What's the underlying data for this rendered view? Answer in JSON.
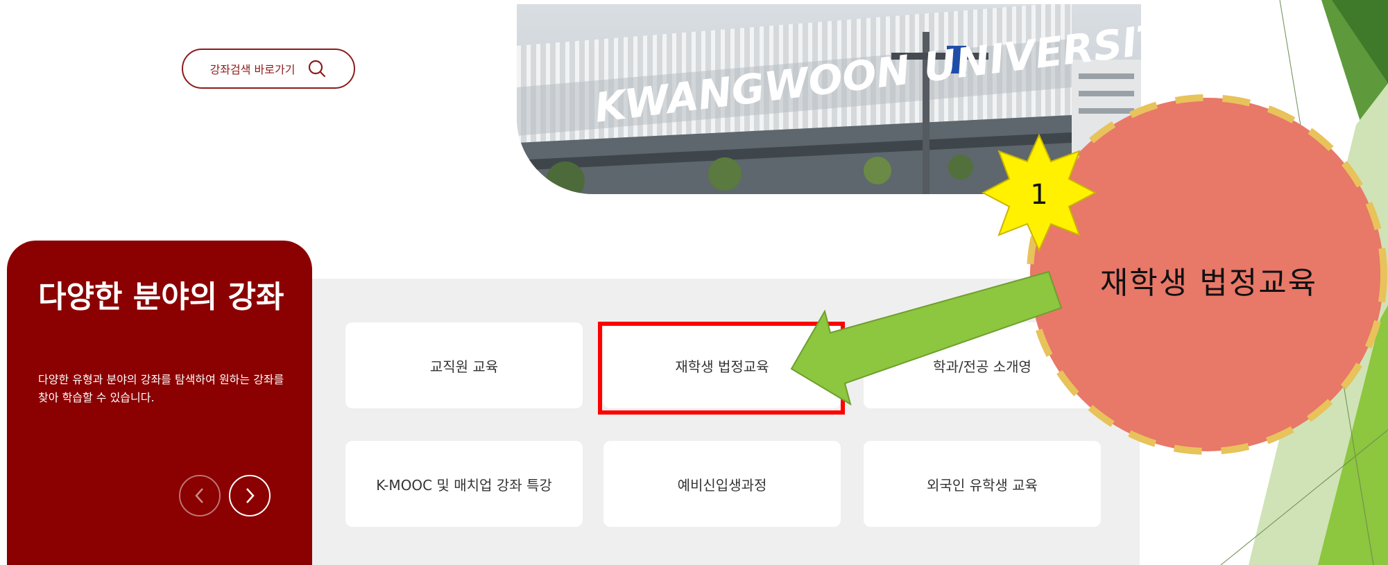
{
  "search": {
    "label": "강좌검색 바로가기",
    "icon": "search-icon"
  },
  "hero": {
    "sign_text": "KWANGWOON UNIVERSITY"
  },
  "panel": {
    "title": "다양한 분야의 강좌",
    "description": "다양한 유형과 분야의 강좌를 탐색하여 원하는 강좌를 찾아 학습할 수 있습니다.",
    "prev_icon": "chevron-left-icon",
    "next_icon": "chevron-right-icon"
  },
  "cards": [
    {
      "label": "교직원 교육"
    },
    {
      "label": "재학생 법정교육",
      "highlighted": true
    },
    {
      "label": "학과/전공 소개영"
    },
    {
      "label": "K-MOOC 및 매치업 강좌 특강"
    },
    {
      "label": "예비신입생과정"
    },
    {
      "label": "외국인 유학생 교육"
    }
  ],
  "annotation": {
    "step": "1",
    "label": "재학생 법정교육"
  },
  "colors": {
    "brand": "#8b0000",
    "highlight": "#ff0000",
    "callout": "#e87868",
    "callout_border": "#e8c25a",
    "star": "#fff100",
    "arrow": "#8dc63f",
    "decor_green": "#5e9a3b"
  }
}
